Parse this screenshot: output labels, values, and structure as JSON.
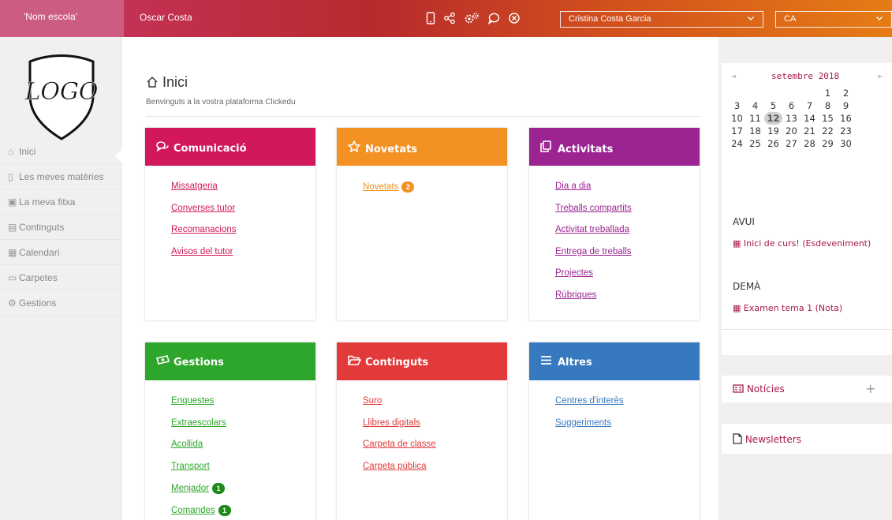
{
  "topbar": {
    "school": "'Nom escola'",
    "user": "Oscar Costa",
    "selected_user": "Cristina Costa Garcia",
    "language": "CA",
    "icons": [
      "phone-icon",
      "share-icon",
      "settings-icon",
      "chat-icon",
      "close-circle-icon"
    ]
  },
  "sidebar": {
    "logo_text": "LOGO",
    "items": [
      {
        "label": "Inici",
        "icon": "home-icon"
      },
      {
        "label": "Les meves matèries",
        "icon": "bookmark-icon"
      },
      {
        "label": "La meva fitxa",
        "icon": "profile-card-icon"
      },
      {
        "label": "Continguts",
        "icon": "content-icon"
      },
      {
        "label": "Calendari",
        "icon": "calendar-icon"
      },
      {
        "label": "Carpetes",
        "icon": "folder-icon"
      },
      {
        "label": "Gestions",
        "icon": "gestions-icon"
      }
    ]
  },
  "main": {
    "title": "Inici",
    "subtitle": "Benvinguts a la vostra plataforma Clickedu",
    "cards": [
      {
        "title": "Comunicació",
        "color": "#d0185a",
        "link_color": "#d0185a",
        "icon": "speech-bubbles-icon",
        "links": [
          {
            "label": "Missatgeria"
          },
          {
            "label": "Converses tutor"
          },
          {
            "label": "Recomanacions"
          },
          {
            "label": "Avisos del tutor"
          }
        ]
      },
      {
        "title": "Novetats",
        "color": "#f39223",
        "link_color": "#f39223",
        "icon": "star-icon",
        "links": [
          {
            "label": "Novetats",
            "badge": "2"
          }
        ]
      },
      {
        "title": "Activitats",
        "color": "#9b2392",
        "link_color": "#9b2392",
        "icon": "copy-icon",
        "links": [
          {
            "label": "Dia a dia"
          },
          {
            "label": "Treballs compartits"
          },
          {
            "label": "Activitat treballada"
          },
          {
            "label": "Entrega de treballs"
          },
          {
            "label": "Projectes"
          },
          {
            "label": "Rúbriques"
          }
        ]
      },
      {
        "title": "Gestions",
        "color": "#2ea62c",
        "link_color": "#2ea62c",
        "icon": "money-icon",
        "links": [
          {
            "label": "Enquestes"
          },
          {
            "label": "Extraescolars"
          },
          {
            "label": "Acollida"
          },
          {
            "label": "Transport"
          },
          {
            "label": "Menjador",
            "badge": "1"
          },
          {
            "label": "Comandes",
            "badge": "1"
          }
        ]
      },
      {
        "title": "Continguts",
        "color": "#e23a3a",
        "link_color": "#e23a3a",
        "icon": "folder-open-icon",
        "links": [
          {
            "label": "Suro"
          },
          {
            "label": "Llibres digitals"
          },
          {
            "label": "Carpeta de classe"
          },
          {
            "label": "Carpeta pública"
          }
        ]
      },
      {
        "title": "Altres",
        "color": "#3679be",
        "link_color": "#3679be",
        "icon": "list-icon",
        "links": [
          {
            "label": "Centres d'interès"
          },
          {
            "label": "Suggeriments"
          }
        ]
      }
    ]
  },
  "calendar": {
    "month": "setembre 2018",
    "prev": "◄",
    "next": "►",
    "today": "12",
    "weeks": [
      [
        "",
        "",
        "",
        "",
        "",
        "1",
        "2"
      ],
      [
        "3",
        "4",
        "5",
        "6",
        "7",
        "8",
        "9"
      ],
      [
        "10",
        "11",
        "12",
        "13",
        "14",
        "15",
        "16"
      ],
      [
        "17",
        "18",
        "19",
        "20",
        "21",
        "22",
        "23"
      ],
      [
        "24",
        "25",
        "26",
        "27",
        "28",
        "29",
        "30"
      ]
    ],
    "today_label": "AVUI",
    "today_event": "Inici de curs! (Esdeveniment)",
    "tomorrow_label": "DEMÀ",
    "tomorrow_event": "Examen tema 1 (Nota)"
  },
  "widgets": {
    "news": "Notícies",
    "news_add": "+",
    "newsletters": "Newsletters"
  }
}
